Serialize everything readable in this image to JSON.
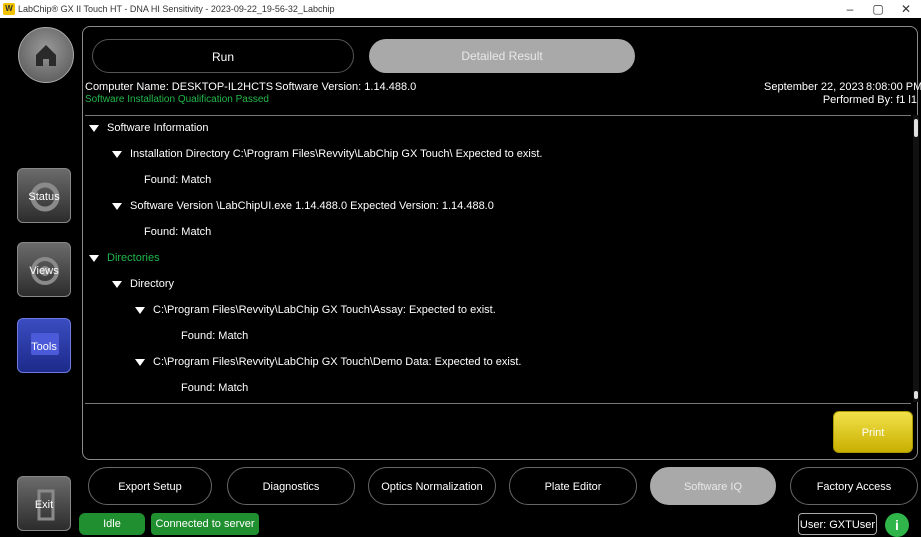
{
  "window": {
    "title": "LabChip® GX II Touch HT - DNA HI Sensitivity - 2023-09-22_19-56-32_Labchip",
    "app_icon_letter": "W",
    "minimize": "–",
    "maximize": "▢",
    "close": "✕"
  },
  "sidebar": {
    "items": [
      {
        "label": "Status",
        "icon": "refresh-icon"
      },
      {
        "label": "Views",
        "icon": "eye-icon"
      },
      {
        "label": "Tools",
        "icon": "toolbox-icon"
      },
      {
        "label": "Exit",
        "icon": "exit-door-icon"
      }
    ]
  },
  "tabs": {
    "run": "Run",
    "detailed_result": "Detailed Result"
  },
  "info": {
    "computer_name": "Computer Name: DESKTOP-IL2HCTS",
    "software_version": "Software Version: 1.14.488.0",
    "qualification": "Software Installation Qualification Passed",
    "date": "September 22, 2023",
    "time": "8:08:00 PM",
    "performed_by": "Performed By: f1 l1"
  },
  "tree": [
    {
      "text": "Software Information",
      "expanded": true,
      "green": false
    },
    {
      "text": "Installation Directory C:\\Program Files\\Revvity\\LabChip GX Touch\\     Expected to exist.",
      "expanded": true,
      "green": false
    },
    {
      "text": "Found: Match",
      "expanded": false,
      "green": false
    },
    {
      "text": "Software Version \\LabChipUI.exe 1.14.488.0     Expected Version: 1.14.488.0",
      "expanded": true,
      "green": false
    },
    {
      "text": "Found: Match",
      "expanded": false,
      "green": false
    },
    {
      "text": "Directories",
      "expanded": true,
      "green": true
    },
    {
      "text": "Directory",
      "expanded": true,
      "green": false
    },
    {
      "text": "C:\\Program Files\\Revvity\\LabChip GX Touch\\Assay:  Expected to exist.",
      "expanded": true,
      "green": false
    },
    {
      "text": "Found: Match",
      "expanded": false,
      "green": false
    },
    {
      "text": "C:\\Program Files\\Revvity\\LabChip GX Touch\\Demo Data:  Expected to exist.",
      "expanded": true,
      "green": false
    },
    {
      "text": "Found: Match",
      "expanded": false,
      "green": false
    }
  ],
  "print_label": "Print",
  "bottom_tabs": [
    {
      "label": "Export Setup",
      "active": false
    },
    {
      "label": "Diagnostics",
      "active": false
    },
    {
      "label": "Optics Normalization",
      "active": false
    },
    {
      "label": "Plate Editor",
      "active": false
    },
    {
      "label": "Software IQ",
      "active": true
    },
    {
      "label": "Factory Access",
      "active": false
    }
  ],
  "status_bar": {
    "state": "Idle",
    "connection": "Connected to server",
    "user": "User: GXTUser",
    "info_icon": "info-icon"
  },
  "colors": {
    "accent_green": "#22b84a",
    "status_green": "#1f8f2f",
    "print_yellow": "#e0cc20",
    "active_tab": "#a9a9a9"
  }
}
